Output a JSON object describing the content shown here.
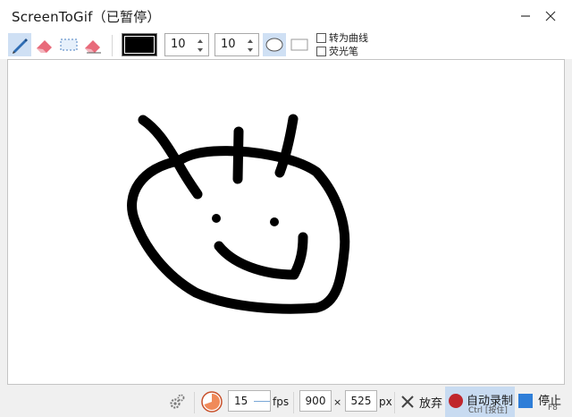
{
  "window": {
    "title": "ScreenToGif（已暂停）"
  },
  "toolbar": {
    "tools": [
      {
        "name": "pen",
        "icon": "pen-icon",
        "active": true
      },
      {
        "name": "eraser",
        "icon": "eraser-icon",
        "active": false
      },
      {
        "name": "select",
        "icon": "selection-icon",
        "active": false
      },
      {
        "name": "stroke-eraser",
        "icon": "stroke-eraser-icon",
        "active": false
      }
    ],
    "color": "#000000",
    "width_value": "10",
    "height_value": "10",
    "shapes": [
      {
        "name": "ellipse",
        "icon": "ellipse-icon",
        "active": true
      },
      {
        "name": "rectangle",
        "icon": "rectangle-icon",
        "active": false
      }
    ],
    "fit_to_curve_label": "转为曲线",
    "highlighter_label": "荧光笔"
  },
  "statusbar": {
    "fps_value": "15",
    "fps_unit": "fps",
    "width_value": "900",
    "times": "×",
    "height_value": "525",
    "px_unit": "px",
    "discard_label": "放弃",
    "record_label": "自动录制",
    "record_shortcut": "Ctrl [按住]",
    "stop_label": "停止",
    "stop_shortcut": "F8"
  },
  "colors": {
    "accent": "#cfe0f4",
    "record": "#c0262c",
    "stop": "#2f7ed8"
  }
}
